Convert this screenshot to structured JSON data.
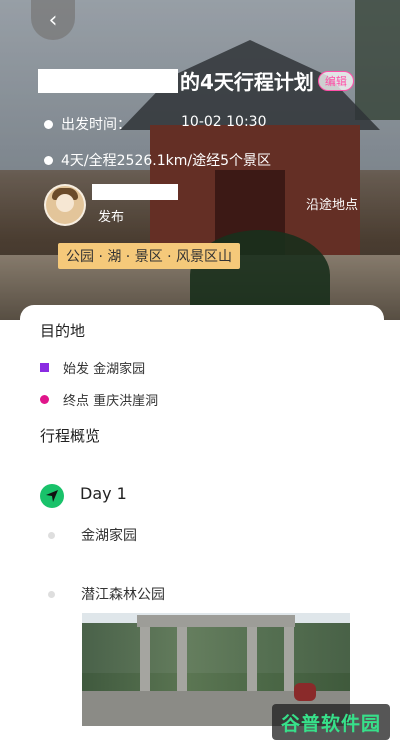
{
  "hero": {
    "back_icon": "chevron-left-icon",
    "title": "的4天行程计划",
    "edit_label": "编辑",
    "depart_label": "出发时间：",
    "depart_time": "10-02 10:30",
    "summary": "4天/全程2526.1km/途经5个景区",
    "publish_label": "发布",
    "route_points_label": "沿途地点",
    "tags": "公园 · 湖 · 景区 · 风景区山"
  },
  "destination": {
    "section_title": "目的地",
    "start": "始发 金湖家园",
    "end": "终点 重庆洪崖洞",
    "start_color": "#8a2be2",
    "end_color": "#e0158a"
  },
  "overview": {
    "section_title": "行程概览",
    "day_label": "Day 1",
    "stops": [
      "金湖家园",
      "潜江森林公园"
    ]
  },
  "watermark": "谷普软件园"
}
